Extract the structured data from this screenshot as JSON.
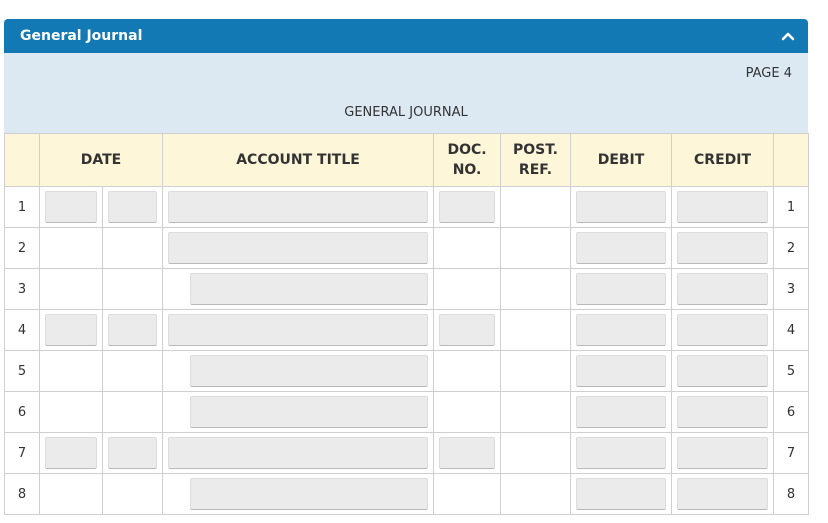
{
  "panel": {
    "title": "General Journal",
    "toggle_icon": "chevron-up-icon"
  },
  "journal": {
    "page_label": "PAGE 4",
    "title": "GENERAL JOURNAL"
  },
  "columns": {
    "date": "DATE",
    "account_title": "ACCOUNT TITLE",
    "doc_no_line1": "DOC.",
    "doc_no_line2": "NO.",
    "post_ref_line1": "POST.",
    "post_ref_line2": "REF.",
    "debit": "DEBIT",
    "credit": "CREDIT"
  },
  "rows": [
    {
      "number": "1",
      "date_fields": true,
      "account_indent": false,
      "doc_field": true
    },
    {
      "number": "2",
      "date_fields": false,
      "account_indent": false,
      "doc_field": false
    },
    {
      "number": "3",
      "date_fields": false,
      "account_indent": true,
      "doc_field": false
    },
    {
      "number": "4",
      "date_fields": true,
      "account_indent": false,
      "doc_field": true
    },
    {
      "number": "5",
      "date_fields": false,
      "account_indent": true,
      "doc_field": false
    },
    {
      "number": "6",
      "date_fields": false,
      "account_indent": true,
      "doc_field": false
    },
    {
      "number": "7",
      "date_fields": true,
      "account_indent": false,
      "doc_field": true
    },
    {
      "number": "8",
      "date_fields": false,
      "account_indent": true,
      "doc_field": false
    }
  ]
}
